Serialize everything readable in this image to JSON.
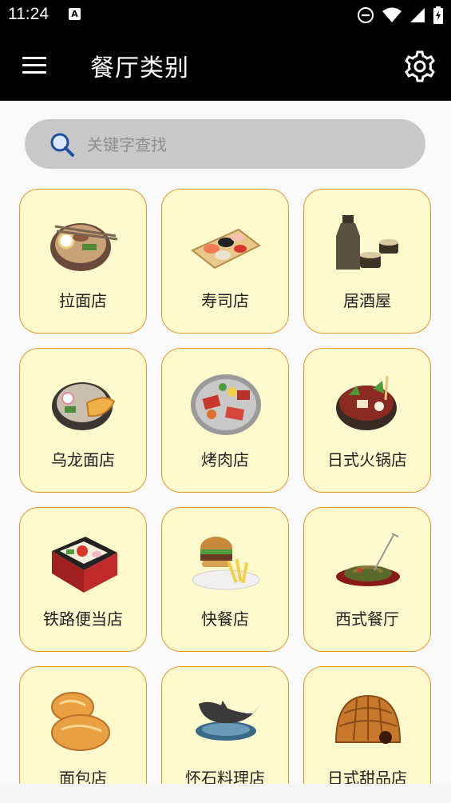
{
  "status_bar": {
    "time": "11:24",
    "icons": [
      "a-notification-icon",
      "do-not-disturb-icon",
      "wifi-icon",
      "signal-icon",
      "battery-icon"
    ]
  },
  "app_bar": {
    "title": "餐厅类别",
    "menu_icon": "hamburger-menu-icon",
    "settings_icon": "gear-icon"
  },
  "search": {
    "placeholder": "关键字查找",
    "value": ""
  },
  "colors": {
    "card_bg": "#fffacd",
    "card_border": "#e8952f",
    "bar_bg": "#000000",
    "search_bg": "#c8c8c8"
  },
  "categories": [
    {
      "label": "拉面店",
      "icon": "ramen-bowl-icon"
    },
    {
      "label": "寿司店",
      "icon": "sushi-plate-icon"
    },
    {
      "label": "居酒屋",
      "icon": "sake-bottle-icon"
    },
    {
      "label": "乌龙面店",
      "icon": "udon-bowl-icon"
    },
    {
      "label": "烤肉店",
      "icon": "yakiniku-grill-icon"
    },
    {
      "label": "日式火锅店",
      "icon": "hotpot-icon"
    },
    {
      "label": "铁路便当店",
      "icon": "bento-box-icon"
    },
    {
      "label": "快餐店",
      "icon": "burger-fries-icon"
    },
    {
      "label": "西式餐厅",
      "icon": "pasta-plate-icon"
    },
    {
      "label": "面包店",
      "icon": "bread-loaves-icon"
    },
    {
      "label": "怀石料理店",
      "icon": "fish-dish-icon"
    },
    {
      "label": "日式甜品店",
      "icon": "sweet-bun-icon"
    }
  ]
}
